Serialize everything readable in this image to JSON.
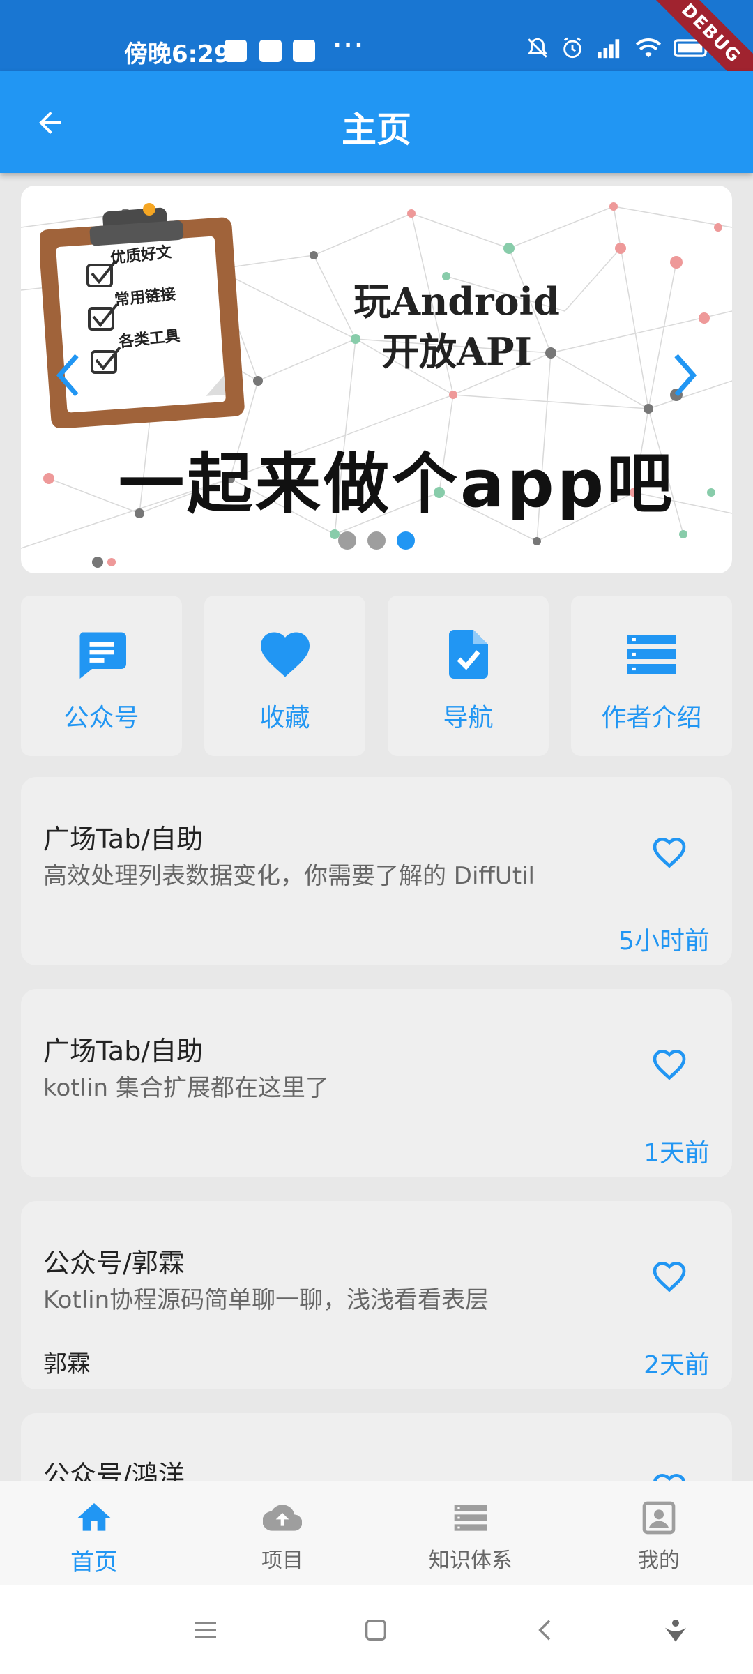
{
  "status_bar": {
    "time": "傍晚6:29",
    "dots": "···"
  },
  "debug_label": "DEBUG",
  "app_bar": {
    "title": "主页"
  },
  "banner": {
    "checklist": [
      "优质好文",
      "常用链接",
      "各类工具"
    ],
    "api_line1": "玩Android",
    "api_line2": "开放API",
    "slogan": "一起来做个app吧",
    "pages": 3,
    "active_page": 3
  },
  "menu": [
    {
      "icon": "chat-icon",
      "label": "公众号"
    },
    {
      "icon": "heart-icon",
      "label": "收藏"
    },
    {
      "icon": "document-check-icon",
      "label": "导航"
    },
    {
      "icon": "list-icon",
      "label": "作者介绍"
    }
  ],
  "articles": [
    {
      "title": "广场Tab/自助",
      "desc": "高效处理列表数据变化，你需要了解的 DiffUtil",
      "author": "",
      "time": "5小时前"
    },
    {
      "title": "广场Tab/自助",
      "desc": "kotlin 集合扩展都在这里了",
      "author": "",
      "time": "1天前"
    },
    {
      "title": "公众号/郭霖",
      "desc": "Kotlin协程源码简单聊一聊，浅浅看看表层",
      "author": "郭霖",
      "time": "2天前"
    },
    {
      "title": "公众号/鸿洋",
      "desc": "",
      "author": "",
      "time": ""
    }
  ],
  "bottom_nav": [
    {
      "icon": "home-icon",
      "label": "首页",
      "active": true
    },
    {
      "icon": "cloud-upload-icon",
      "label": "项目",
      "active": false
    },
    {
      "icon": "storage-icon",
      "label": "知识体系",
      "active": false
    },
    {
      "icon": "account-box-icon",
      "label": "我的",
      "active": false
    }
  ],
  "colors": {
    "primary": "#2196f3",
    "status_bar": "#1976d2",
    "debug": "#a0232f"
  }
}
